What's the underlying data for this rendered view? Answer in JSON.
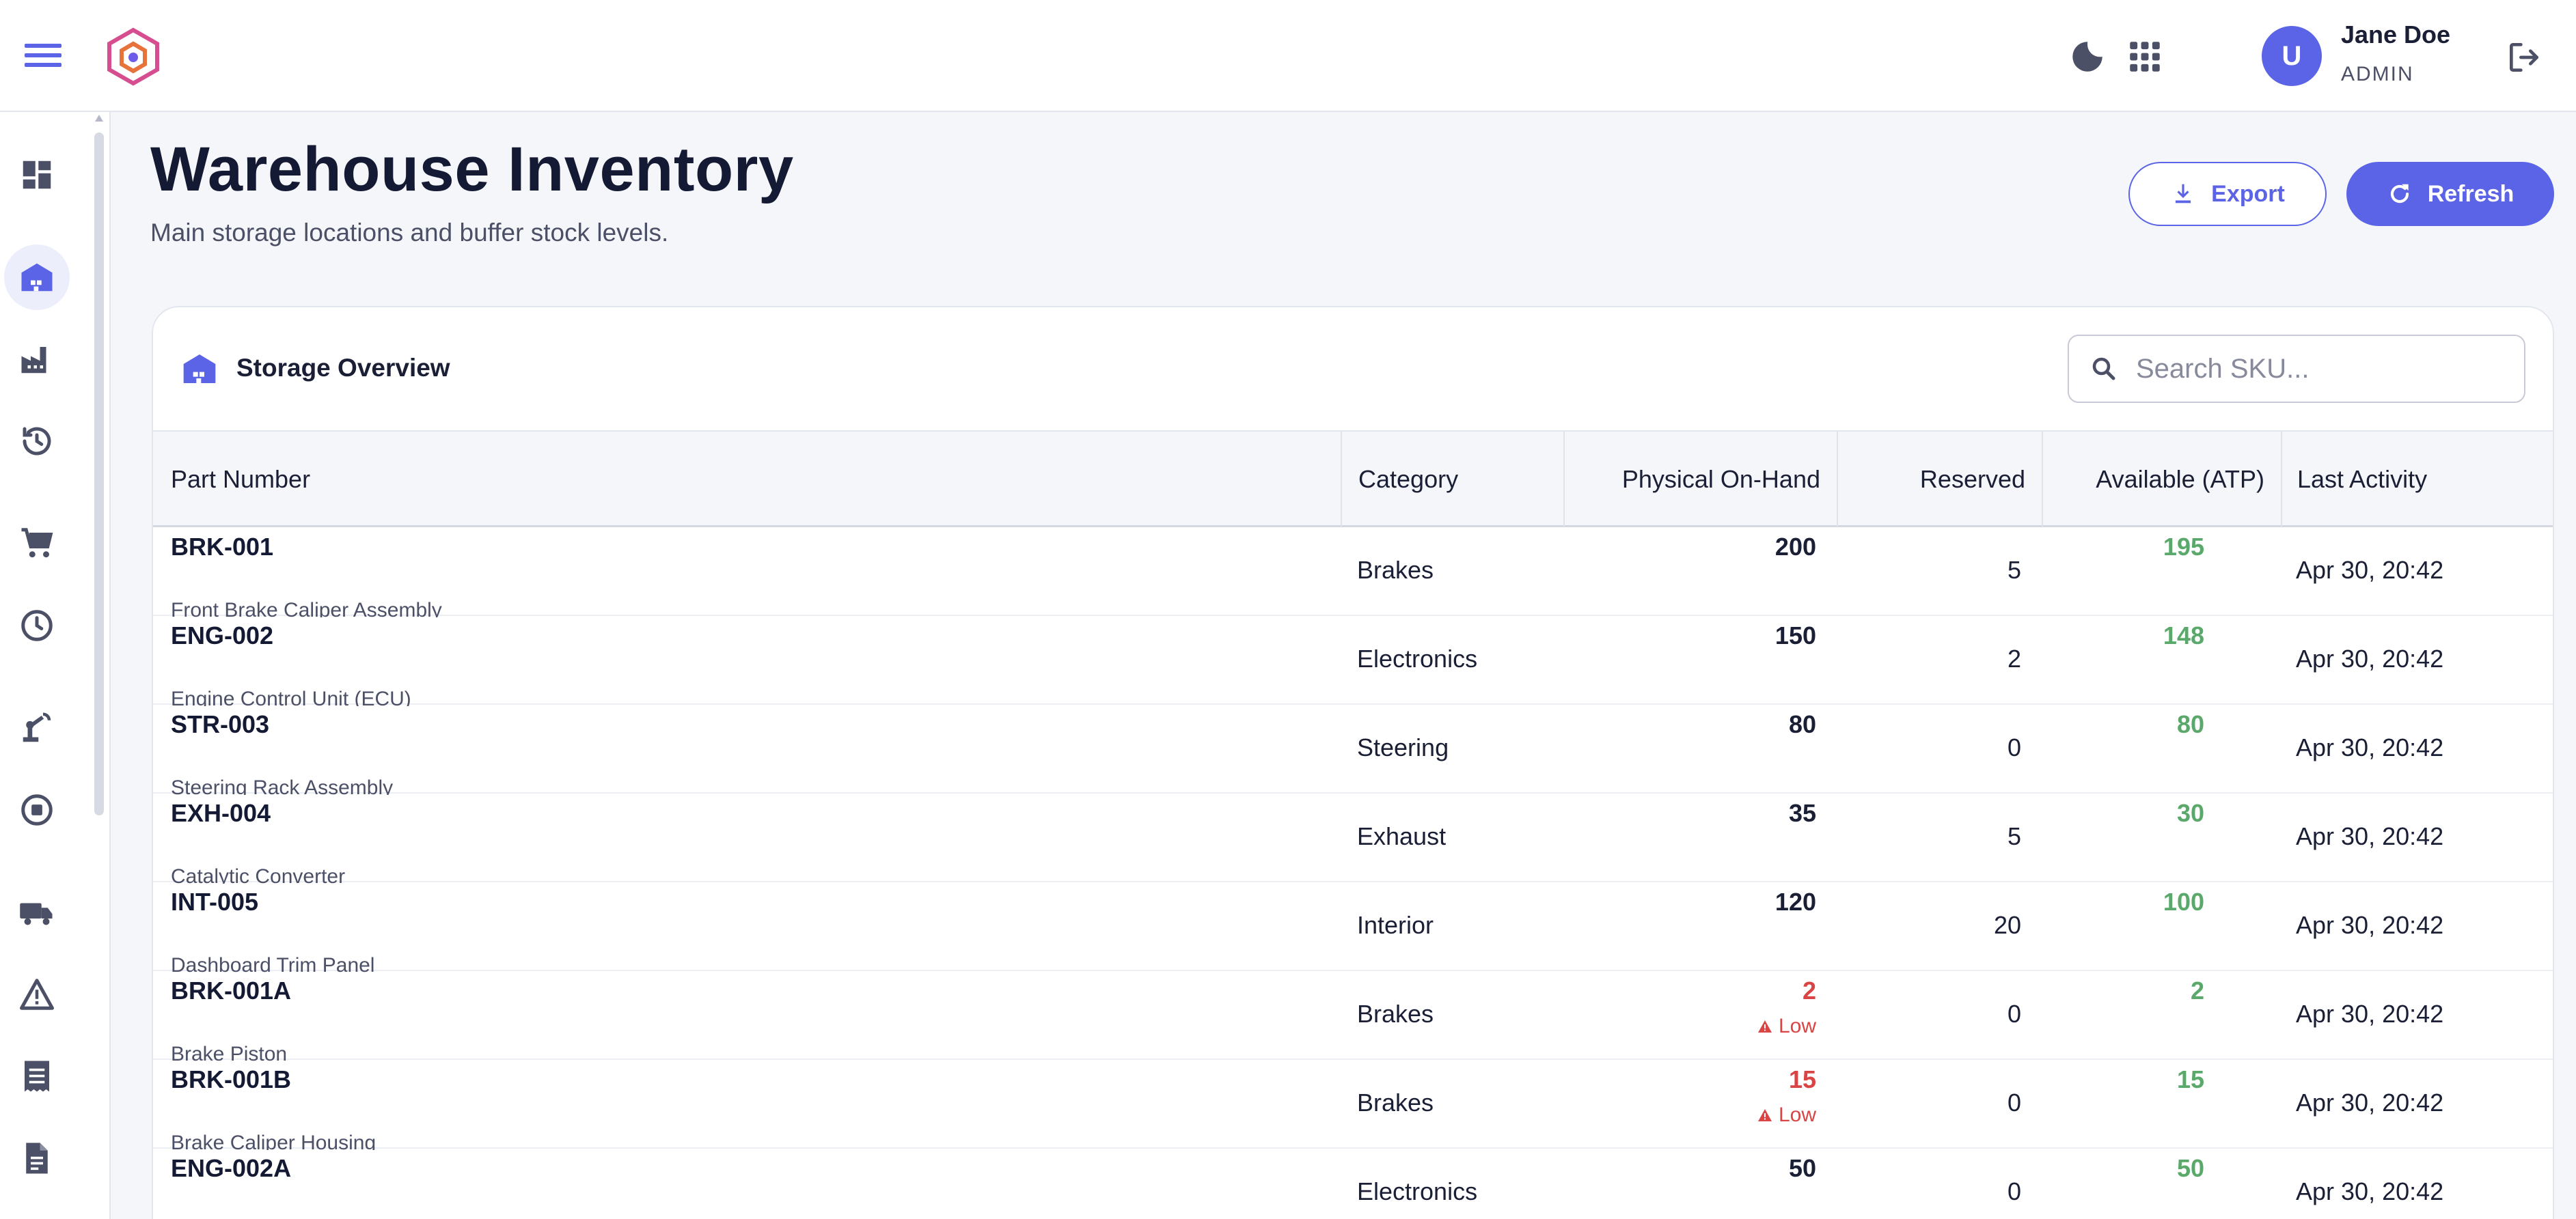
{
  "user": {
    "initial": "U",
    "name": "Jane Doe",
    "role": "ADMIN"
  },
  "page": {
    "title": "Warehouse Inventory",
    "subtitle": "Main storage locations and buffer stock levels."
  },
  "actions": {
    "export_label": "Export",
    "refresh_label": "Refresh"
  },
  "card": {
    "title": "Storage Overview",
    "search_placeholder": "Search SKU..."
  },
  "table": {
    "headers": {
      "part": "Part Number",
      "category": "Category",
      "onhand": "Physical On-Hand",
      "reserved": "Reserved",
      "atp": "Available (ATP)",
      "activity": "Last Activity"
    },
    "low_label": "Low",
    "rows": [
      {
        "part": "BRK-001",
        "desc": "Front Brake Caliper Assembly",
        "category": "Brakes",
        "onhand": "200",
        "reserved": "5",
        "atp": "195",
        "activity": "Apr 30, 20:42"
      },
      {
        "part": "ENG-002",
        "desc": "Engine Control Unit (ECU)",
        "category": "Electronics",
        "onhand": "150",
        "reserved": "2",
        "atp": "148",
        "activity": "Apr 30, 20:42"
      },
      {
        "part": "STR-003",
        "desc": "Steering Rack Assembly",
        "category": "Steering",
        "onhand": "80",
        "reserved": "0",
        "atp": "80",
        "activity": "Apr 30, 20:42"
      },
      {
        "part": "EXH-004",
        "desc": "Catalytic Converter",
        "category": "Exhaust",
        "onhand": "35",
        "reserved": "5",
        "atp": "30",
        "activity": "Apr 30, 20:42"
      },
      {
        "part": "INT-005",
        "desc": "Dashboard Trim Panel",
        "category": "Interior",
        "onhand": "120",
        "reserved": "20",
        "atp": "100",
        "activity": "Apr 30, 20:42"
      },
      {
        "part": "BRK-001A",
        "desc": "Brake Piston",
        "category": "Brakes",
        "onhand": "2",
        "low": true,
        "reserved": "0",
        "atp": "2",
        "activity": "Apr 30, 20:42"
      },
      {
        "part": "BRK-001B",
        "desc": "Brake Caliper Housing",
        "category": "Brakes",
        "onhand": "15",
        "low": true,
        "reserved": "0",
        "atp": "15",
        "activity": "Apr 30, 20:42"
      },
      {
        "part": "ENG-002A",
        "desc": "",
        "category": "Electronics",
        "onhand": "50",
        "reserved": "0",
        "atp": "50",
        "activity": "Apr 30, 20:42"
      }
    ]
  },
  "icons": {
    "menu": "hamburger-menu-icon",
    "theme": "moon-icon",
    "apps": "apps-grid-icon",
    "logout": "logout-icon"
  },
  "colors": {
    "accent": "#5b63e6",
    "positive": "#5aa96b",
    "danger": "#d94444",
    "text": "#1a1f36"
  }
}
